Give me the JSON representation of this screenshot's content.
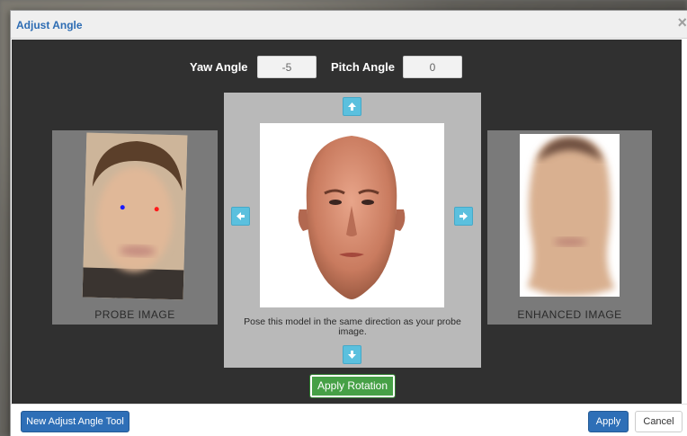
{
  "dialog": {
    "title": "Adjust Angle",
    "close_glyph": "×"
  },
  "angles": {
    "yaw_label": "Yaw Angle",
    "yaw_value": "-5",
    "pitch_label": "Pitch Angle",
    "pitch_value": "0"
  },
  "probe": {
    "caption": "PROBE IMAGE"
  },
  "enhanced": {
    "caption": "ENHANCED IMAGE"
  },
  "model": {
    "hint": "Pose this model in the same direction as your probe image.",
    "arrows": {
      "up": "arrow-up-icon",
      "down": "arrow-down-icon",
      "left": "arrow-left-icon",
      "right": "arrow-right-icon"
    }
  },
  "actions": {
    "apply_rotation": "Apply Rotation",
    "new_tool": "New Adjust Angle Tool",
    "apply": "Apply",
    "cancel": "Cancel"
  },
  "colors": {
    "title": "#2d6cb3",
    "primary": "#2e6fb7",
    "success": "#46a046",
    "info": "#5bc0de",
    "body_bg": "#303030"
  }
}
